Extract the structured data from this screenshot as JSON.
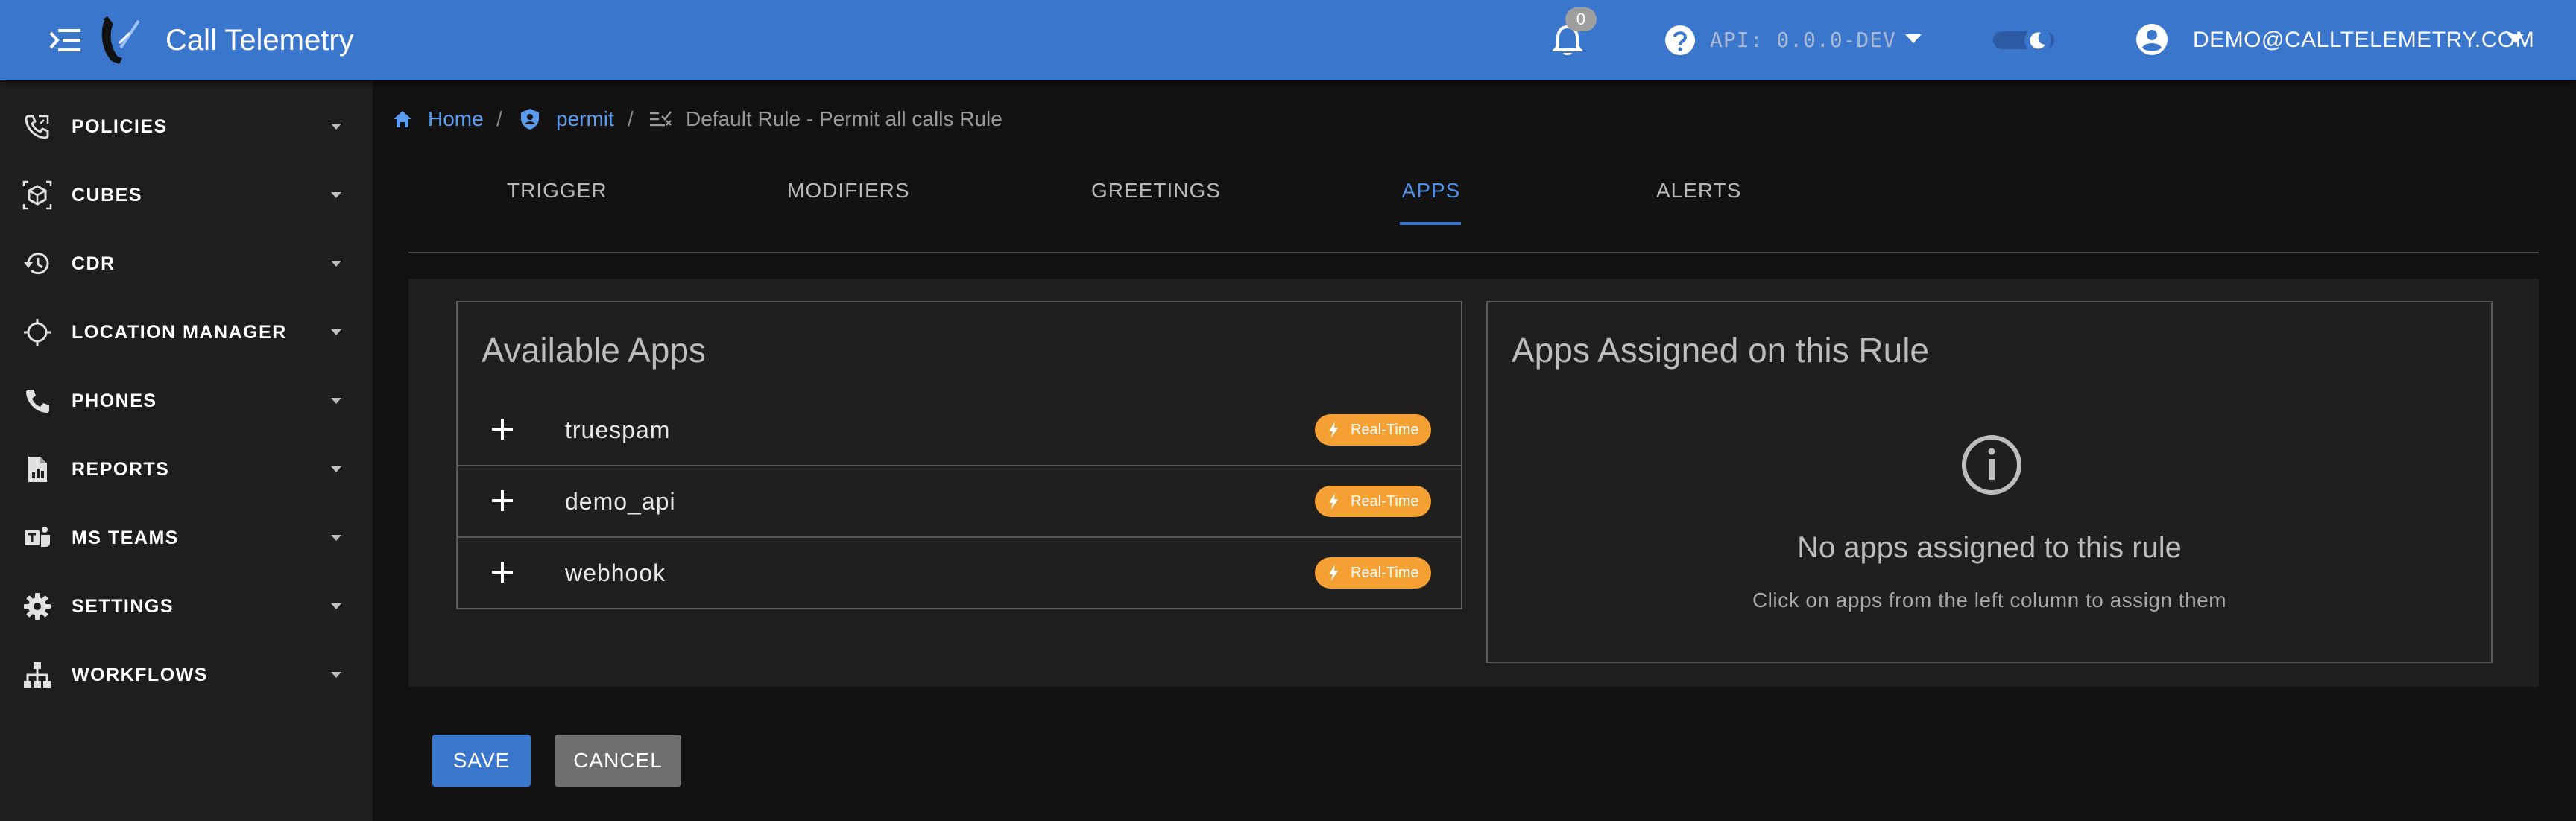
{
  "app": {
    "title": "Call Telemetry"
  },
  "header": {
    "notifications_count": "0",
    "api_version": "API: 0.0.0-DEV",
    "user_email": "DEMO@CALLTELEMETRY.COM"
  },
  "sidebar": {
    "items": [
      {
        "label": "POLICIES",
        "icon": "phone-policy-icon"
      },
      {
        "label": "CUBES",
        "icon": "cube-icon"
      },
      {
        "label": "CDR",
        "icon": "history-icon"
      },
      {
        "label": "LOCATION MANAGER",
        "icon": "crosshair-icon"
      },
      {
        "label": "PHONES",
        "icon": "phone-icon"
      },
      {
        "label": "REPORTS",
        "icon": "report-icon"
      },
      {
        "label": "MS TEAMS",
        "icon": "teams-icon"
      },
      {
        "label": "SETTINGS",
        "icon": "gear-icon"
      },
      {
        "label": "WORKFLOWS",
        "icon": "sitemap-icon"
      }
    ]
  },
  "breadcrumb": {
    "home": "Home",
    "sep": "/",
    "policy": "permit",
    "current": "Default Rule - Permit all calls Rule"
  },
  "tabs": [
    {
      "label": "TRIGGER"
    },
    {
      "label": "MODIFIERS"
    },
    {
      "label": "GREETINGS"
    },
    {
      "label": "APPS"
    },
    {
      "label": "ALERTS"
    }
  ],
  "active_tab": "APPS",
  "available_apps": {
    "title": "Available Apps",
    "items": [
      {
        "name": "truespam",
        "badge": "Real-Time"
      },
      {
        "name": "demo_api",
        "badge": "Real-Time"
      },
      {
        "name": "webhook",
        "badge": "Real-Time"
      }
    ]
  },
  "assigned_apps": {
    "title": "Apps Assigned on this Rule",
    "empty_title": "No apps assigned to this rule",
    "empty_hint": "Click on apps from the left column to assign them"
  },
  "actions": {
    "save": "SAVE",
    "cancel": "CANCEL"
  },
  "colors": {
    "header": "#3a76cc",
    "accent": "#4e8fe8",
    "badge": "#f5a033",
    "background": "#121212",
    "surface": "#1e1e1e"
  }
}
